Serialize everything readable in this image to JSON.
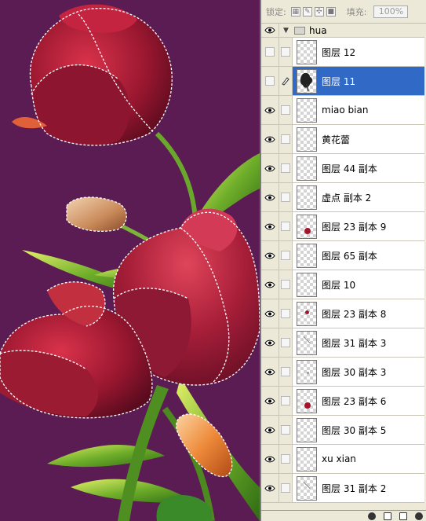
{
  "toolbar": {
    "lock_label": "锁定:",
    "fill_label": "填充:",
    "fill_value": "100%",
    "lock_icons": [
      "lock-transparency-icon",
      "lock-brush-icon",
      "lock-move-icon",
      "lock-all-icon"
    ]
  },
  "layers": {
    "group": {
      "name": "hua",
      "expanded": true,
      "visible": true
    },
    "items": [
      {
        "name": "图层 12",
        "visible": false,
        "selected": false,
        "brush": false,
        "thumb": "blank"
      },
      {
        "name": "图层 11",
        "visible": false,
        "selected": true,
        "brush": true,
        "thumb": "flower"
      },
      {
        "name": "miao bian",
        "visible": true,
        "selected": false,
        "brush": false,
        "thumb": "blank"
      },
      {
        "name": "黄花蕾",
        "visible": true,
        "selected": false,
        "brush": false,
        "thumb": "blank"
      },
      {
        "name": "图层 44 副本",
        "visible": true,
        "selected": false,
        "brush": false,
        "thumb": "blank"
      },
      {
        "name": "虚点 副本 2",
        "visible": true,
        "selected": false,
        "brush": false,
        "thumb": "blank"
      },
      {
        "name": "图层 23 副本 9",
        "visible": true,
        "selected": false,
        "brush": false,
        "thumb": "red"
      },
      {
        "name": "图层 65 副本",
        "visible": true,
        "selected": false,
        "brush": false,
        "thumb": "blank"
      },
      {
        "name": "图层 10",
        "visible": true,
        "selected": false,
        "brush": false,
        "thumb": "blank"
      },
      {
        "name": "图层 23 副本 8",
        "visible": true,
        "selected": false,
        "brush": false,
        "thumb": "red-small"
      },
      {
        "name": "图层 31 副本 3",
        "visible": true,
        "selected": false,
        "brush": false,
        "thumb": "line"
      },
      {
        "name": "图层 30 副本 3",
        "visible": true,
        "selected": false,
        "brush": false,
        "thumb": "dot"
      },
      {
        "name": "图层 23 副本 6",
        "visible": true,
        "selected": false,
        "brush": false,
        "thumb": "red"
      },
      {
        "name": "图层 30 副本 5",
        "visible": true,
        "selected": false,
        "brush": false,
        "thumb": "blank"
      },
      {
        "name": "xu xian",
        "visible": true,
        "selected": false,
        "brush": false,
        "thumb": "blank"
      },
      {
        "name": "图层 31 副本 2",
        "visible": true,
        "selected": false,
        "brush": false,
        "thumb": "line"
      }
    ]
  },
  "colors": {
    "canvas_bg": "#5a1c52",
    "panel_bg": "#ece9d8",
    "selection": "#3169c6"
  }
}
